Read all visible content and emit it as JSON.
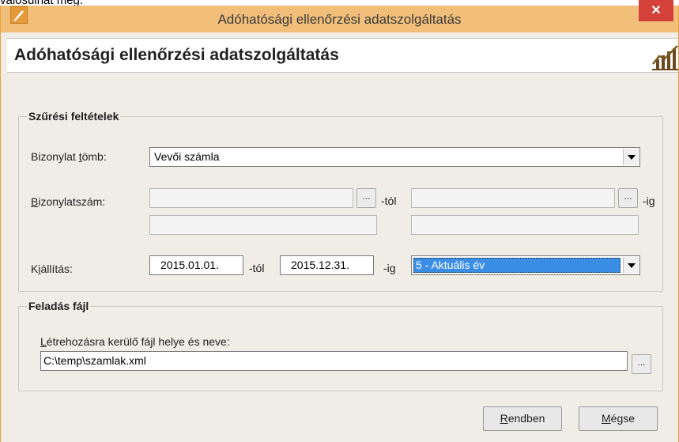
{
  "top_text": "valósulhat meg.",
  "window": {
    "title": "Adóhatósági ellenőrzési adatszolgáltatás",
    "close_label": "✕"
  },
  "header": {
    "title": "Adóhatósági ellenőrzési adatszolgáltatás"
  },
  "filter": {
    "group_label": "Szűrési feltételek",
    "doc_block": {
      "label_pre": "Bizonylat ",
      "label_u": "t",
      "label_post": "ömb:",
      "value": "Vevői számla"
    },
    "doc_number": {
      "label_u": "B",
      "label_post": "izonylatszám:",
      "from_value": "",
      "to_value": "",
      "from_suffix": "-tól",
      "to_suffix": "-ig",
      "browse_label": "...",
      "extra_left": "",
      "extra_right": ""
    },
    "issue": {
      "label_pre": "K",
      "label_u": "i",
      "label_post": "állítás:",
      "from_date": "2015.01.01.",
      "from_suffix": "-tól",
      "to_date": "2015.12.31.",
      "to_suffix": "-ig",
      "period": "5 - Aktuális év"
    }
  },
  "output": {
    "group_label": "Feladás fájl",
    "path_label_u": "L",
    "path_label_post": "étrehozásra kerülő fájl helye és neve:",
    "path_value": "C:\\temp\\szamlak.xml",
    "browse_label": "..."
  },
  "buttons": {
    "ok_u": "R",
    "ok_post": "endben",
    "cancel_u": "M",
    "cancel_post": "égse"
  },
  "colors": {
    "titlebar": "#f1bf7a",
    "close": "#d4413a",
    "selection": "#3a8ee6",
    "window_bg": "#f0ede6"
  }
}
